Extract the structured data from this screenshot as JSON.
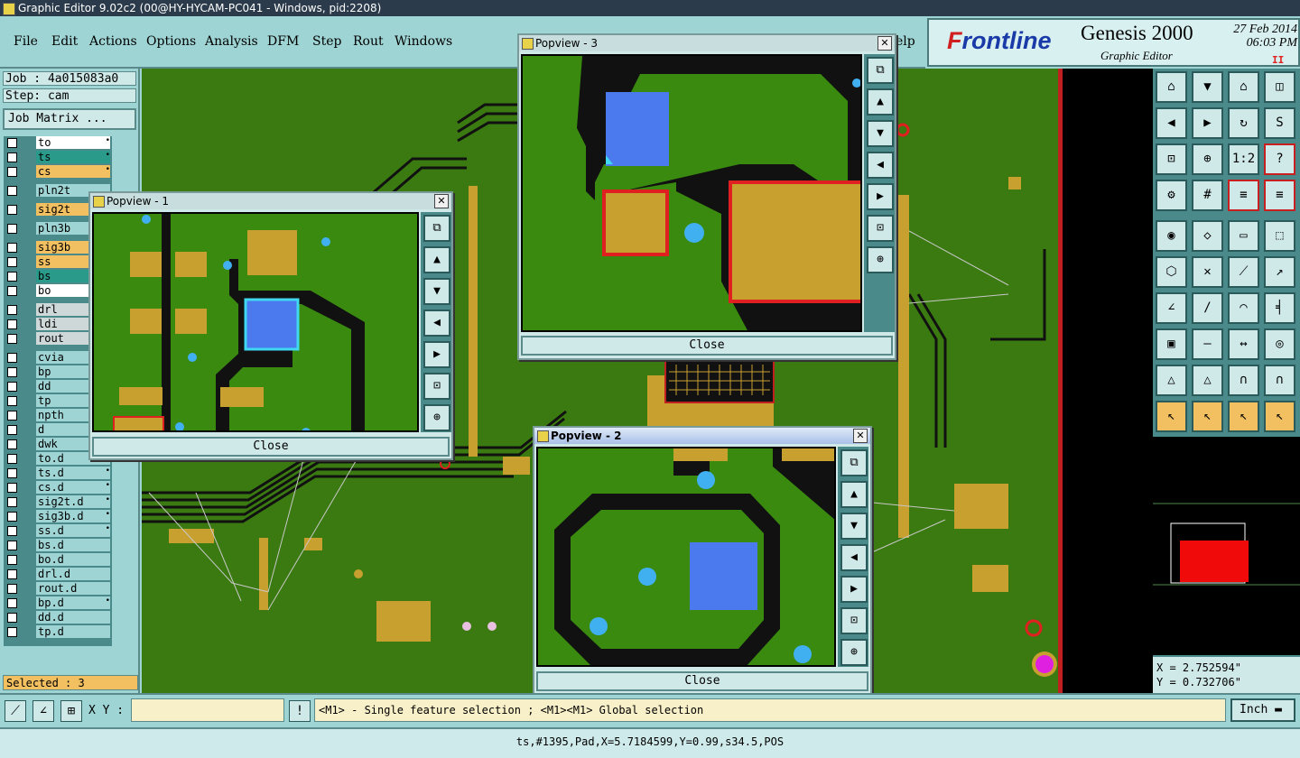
{
  "window": {
    "title": "Graphic Editor 9.02c2 (00@HY-HYCAM-PC041 - Windows, pid:2208)"
  },
  "menu": [
    "File",
    "Edit",
    "Actions",
    "Options",
    "Analysis",
    "DFM",
    "Step",
    "Rout",
    "Windows"
  ],
  "menu_partial": "elp",
  "brand": {
    "logo_prefix": "F",
    "logo": "rontline",
    "product": "Genesis 2000",
    "subtitle": "Graphic Editor",
    "date": "27 Feb 2014",
    "time": "06:03 PM",
    "pause": "II"
  },
  "job": {
    "job": "Job : 4a015083a0",
    "step": "Step: cam",
    "matrix": "Job Matrix ...",
    "selected": "Selected : 3"
  },
  "layers": [
    {
      "name": "to",
      "color": "#ffffff",
      "mark": "•"
    },
    {
      "name": "ts",
      "color": "#2a9a8a",
      "mark": "•"
    },
    {
      "name": "cs",
      "color": "#f2c060",
      "mark": "•"
    },
    {
      "name": "pln2t",
      "color": "#9fd4d4",
      "mark": ""
    },
    {
      "name": "sig2t",
      "color": "#f2c060",
      "mark": ""
    },
    {
      "name": "pln3b",
      "color": "#9fd4d4",
      "mark": ""
    },
    {
      "name": "sig3b",
      "color": "#f2c060",
      "mark": ""
    },
    {
      "name": "ss",
      "color": "#f2c060",
      "mark": ""
    },
    {
      "name": "bs",
      "color": "#2a9a8a",
      "mark": ""
    },
    {
      "name": "bo",
      "color": "#ffffff",
      "mark": ""
    },
    {
      "name": "drl",
      "color": "#cfd8d8",
      "mark": ""
    },
    {
      "name": "ldi",
      "color": "#cfd8d8",
      "mark": ""
    },
    {
      "name": "rout",
      "color": "#cfd8d8",
      "mark": ""
    },
    {
      "name": "cvia",
      "color": "#9fd4d4",
      "mark": ""
    },
    {
      "name": "bp",
      "color": "#9fd4d4",
      "mark": ""
    },
    {
      "name": "dd",
      "color": "#9fd4d4",
      "mark": ""
    },
    {
      "name": "tp",
      "color": "#9fd4d4",
      "mark": ""
    },
    {
      "name": "npth",
      "color": "#9fd4d4",
      "mark": ""
    },
    {
      "name": "d",
      "color": "#9fd4d4",
      "mark": ""
    },
    {
      "name": "dwk",
      "color": "#9fd4d4",
      "mark": ""
    },
    {
      "name": "to.d",
      "color": "#9fd4d4",
      "mark": "•"
    },
    {
      "name": "ts.d",
      "color": "#9fd4d4",
      "mark": "•"
    },
    {
      "name": "cs.d",
      "color": "#9fd4d4",
      "mark": "•"
    },
    {
      "name": "sig2t.d",
      "color": "#9fd4d4",
      "mark": "•"
    },
    {
      "name": "sig3b.d",
      "color": "#9fd4d4",
      "mark": "•"
    },
    {
      "name": "ss.d",
      "color": "#9fd4d4",
      "mark": "•"
    },
    {
      "name": "bs.d",
      "color": "#9fd4d4",
      "mark": ""
    },
    {
      "name": "bo.d",
      "color": "#9fd4d4",
      "mark": ""
    },
    {
      "name": "drl.d",
      "color": "#9fd4d4",
      "mark": ""
    },
    {
      "name": "rout.d",
      "color": "#9fd4d4",
      "mark": ""
    },
    {
      "name": "bp.d",
      "color": "#9fd4d4",
      "mark": "•"
    },
    {
      "name": "dd.d",
      "color": "#9fd4d4",
      "mark": ""
    },
    {
      "name": "tp.d",
      "color": "#9fd4d4",
      "mark": ""
    }
  ],
  "popups": {
    "p1": {
      "title": "Popview - 1",
      "close": "Close"
    },
    "p2": {
      "title": "Popview - 2",
      "close": "Close"
    },
    "p3": {
      "title": "Popview - 3",
      "close": "Close"
    }
  },
  "coords": {
    "x": "X = 2.752594\"",
    "y": "Y = 0.732706\""
  },
  "bottom": {
    "xy_label": "X Y :",
    "xy_value": "",
    "hint": "<M1> - Single feature selection ; <M1><M1> Global selection",
    "unit": "Inch"
  },
  "status": "ts,#1395,Pad,X=5.7184599,Y=0.99,s34.5,POS",
  "colors": {
    "board": "#3a7a10",
    "copper": "#c8a030",
    "selection": "#4a7aee",
    "drill": "#40b0f0",
    "panel": "#9fd4d4"
  }
}
